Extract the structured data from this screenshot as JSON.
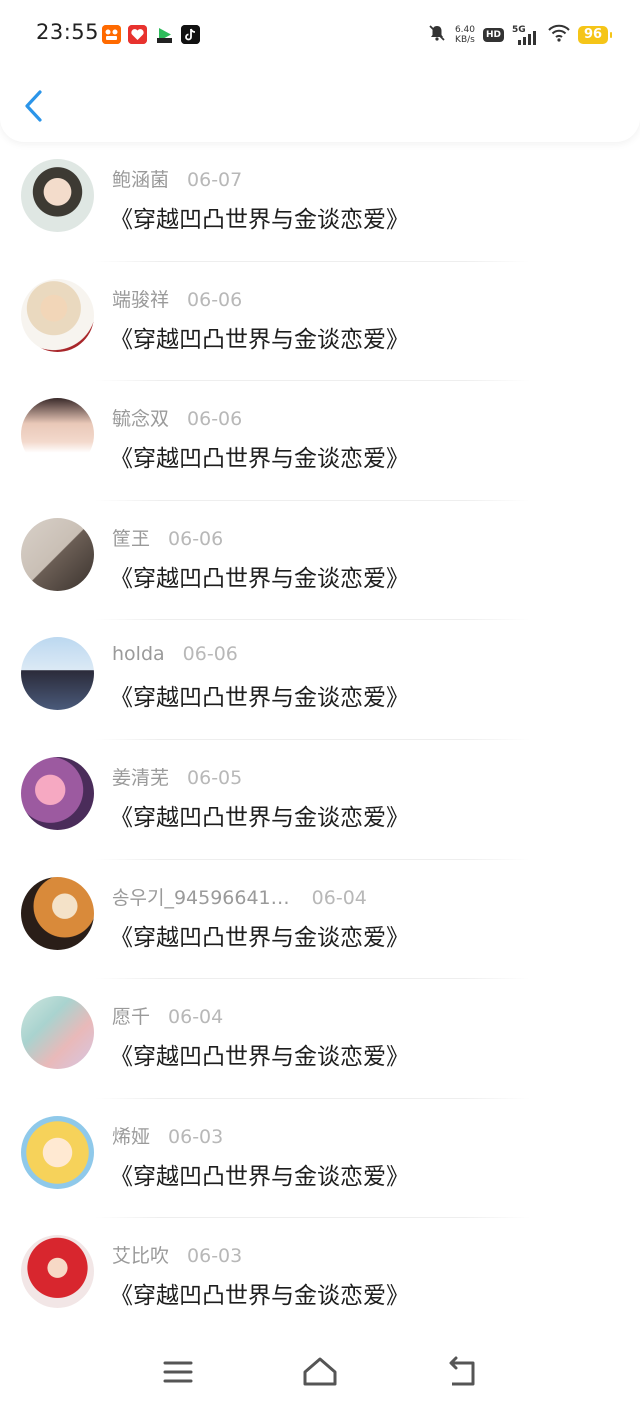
{
  "status_bar": {
    "time": "23:55",
    "app_icons": [
      "app-icon-1",
      "app-icon-2",
      "app-icon-3",
      "tiktok-icon"
    ],
    "net_speed_value": "6.40",
    "net_speed_unit": "KB/s",
    "hd": "HD",
    "network": "5G",
    "battery": "96"
  },
  "header": {
    "back_icon": "chevron-left-icon",
    "accent_color": "#2b95e9"
  },
  "list": {
    "items": [
      {
        "name": "鲍涵菌",
        "date": "06-07",
        "title": "《穿越凹凸世界与金谈恋爱》"
      },
      {
        "name": "端骏祥",
        "date": "06-06",
        "title": "《穿越凹凸世界与金谈恋爱》"
      },
      {
        "name": "毓念双",
        "date": "06-06",
        "title": "《穿越凹凸世界与金谈恋爱》"
      },
      {
        "name": "筐玊",
        "date": "06-06",
        "title": "《穿越凹凸世界与金谈恋爱》"
      },
      {
        "name": "holda",
        "date": "06-06",
        "title": "《穿越凹凸世界与金谈恋爱》"
      },
      {
        "name": "姜清芜",
        "date": "06-05",
        "title": "《穿越凹凸世界与金谈恋爱》"
      },
      {
        "name": "송우기_94596641…",
        "date": "06-04",
        "title": "《穿越凹凸世界与金谈恋爱》"
      },
      {
        "name": "愿千",
        "date": "06-04",
        "title": "《穿越凹凸世界与金谈恋爱》"
      },
      {
        "name": "烯娅",
        "date": "06-03",
        "title": "《穿越凹凸世界与金谈恋爱》"
      },
      {
        "name": "艾比吹",
        "date": "06-03",
        "title": "《穿越凹凸世界与金谈恋爱》"
      }
    ]
  },
  "navbar": {
    "menu_icon": "menu-icon",
    "home_icon": "home-icon",
    "back_icon": "back-icon"
  }
}
